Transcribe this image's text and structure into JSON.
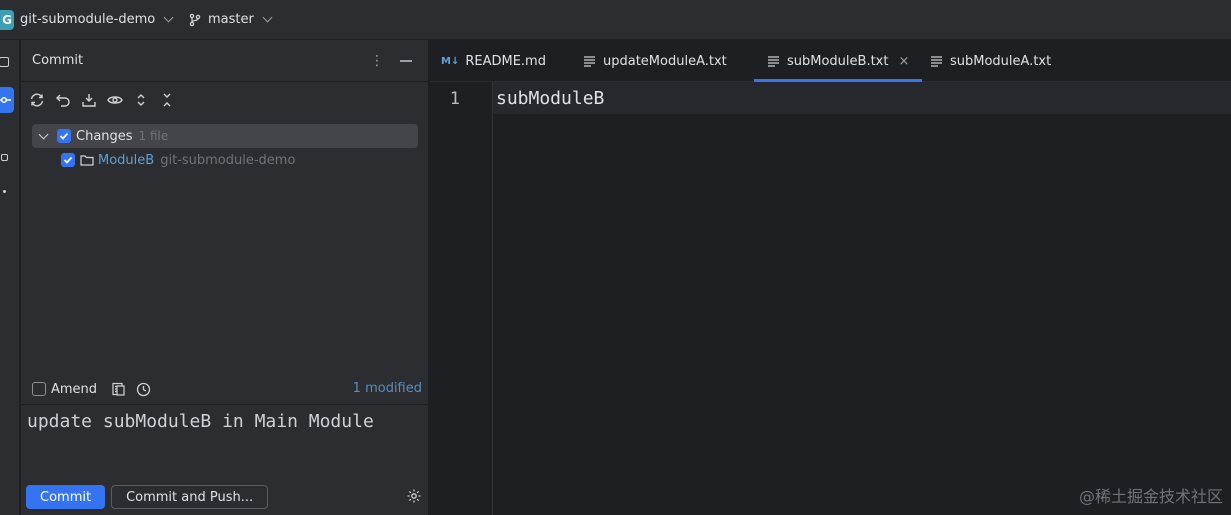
{
  "titlebar": {
    "project_initial": "G",
    "project_name": "git-submodule-demo",
    "branch": "master"
  },
  "commit_panel": {
    "title": "Commit",
    "menu_glyph": "⋮",
    "toolbar": [
      "refresh-icon",
      "rollback-icon",
      "shelve-icon",
      "preview-icon",
      "expand-all-icon",
      "collapse-all-icon"
    ],
    "changes": {
      "label": "Changes",
      "count": "1 file",
      "items": [
        {
          "name": "ModuleB",
          "path": "git-submodule-demo"
        }
      ]
    },
    "amend_label": "Amend",
    "modified": "1 modified",
    "message": "update subModuleB in Main Module",
    "commit_button": "Commit",
    "commit_push_button": "Commit and Push..."
  },
  "tabs": [
    {
      "label": "README.md",
      "icon": "markdown-icon",
      "icon_text": "M↓",
      "active": false
    },
    {
      "label": "updateModuleA.txt",
      "icon": "text-file-icon",
      "active": false
    },
    {
      "label": "subModuleB.txt",
      "icon": "text-file-icon",
      "active": true,
      "close": "×"
    },
    {
      "label": "subModuleA.txt",
      "icon": "text-file-icon",
      "active": false
    }
  ],
  "editor": {
    "line_number": "1",
    "content": "subModuleB"
  },
  "watermark": "@稀土掘金技术社区",
  "colors": {
    "accent": "#3574f0",
    "panel_bg": "#2b2d30",
    "editor_bg": "#1e1f22"
  }
}
